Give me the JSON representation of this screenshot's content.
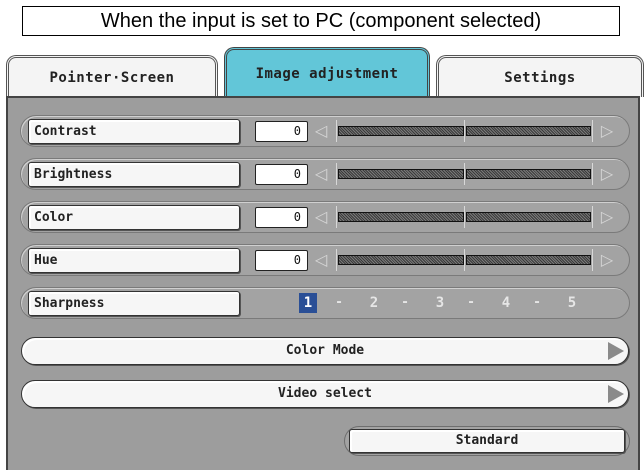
{
  "caption": "When the input is set to PC (component selected)",
  "tabs": [
    {
      "label": "Pointer·Screen",
      "active": false
    },
    {
      "label": "Image adjustment",
      "active": true
    },
    {
      "label": "Settings",
      "active": false
    }
  ],
  "accent_color": "#62c6d8",
  "selected_color": "#2a4f96",
  "adjust": [
    {
      "label": "Contrast",
      "value": "0"
    },
    {
      "label": "Brightness",
      "value": "0"
    },
    {
      "label": "Color",
      "value": "0"
    },
    {
      "label": "Hue",
      "value": "0"
    }
  ],
  "sharpness": {
    "label": "Sharpness",
    "options": [
      "1",
      "2",
      "3",
      "4",
      "5"
    ],
    "selected": "1",
    "separator": "-"
  },
  "buttons": {
    "color_mode": "Color Mode",
    "video_select": "Video select",
    "standard": "Standard"
  },
  "arrows": {
    "left": "◁",
    "right": "▷"
  }
}
